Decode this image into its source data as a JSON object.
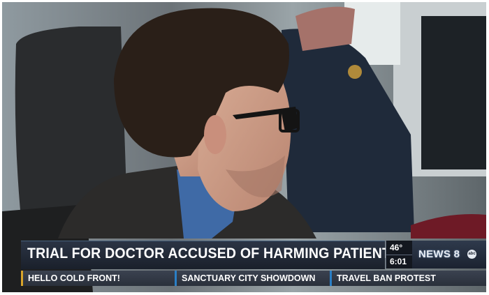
{
  "headline": "TRIAL FOR DOCTOR ACCUSED OF HARMING PATIENTS",
  "weather": {
    "temperature": "46°",
    "time": "6:01"
  },
  "station_logo": {
    "text": "NEWS 8",
    "network": "abc"
  },
  "ticker": [
    "HELLO COLD FRONT!",
    "SANCTUARY CITY SHOWDOWN",
    "TRAVEL BAN PROTEST"
  ],
  "colors": {
    "headline_bar": "#1f2633",
    "ticker_accent_first": "#d8a42a",
    "ticker_accent": "#2a7fc6"
  }
}
